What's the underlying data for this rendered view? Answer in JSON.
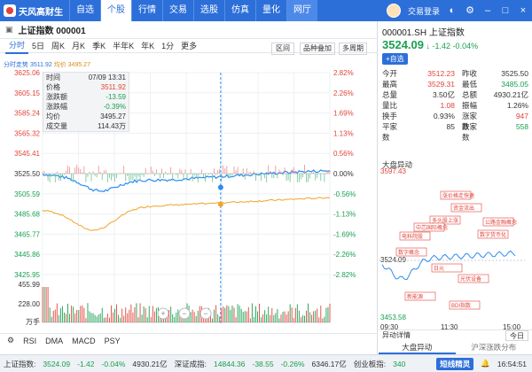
{
  "app": {
    "name": "天风高财生"
  },
  "nav": {
    "tabs": [
      "自选",
      "个股",
      "行情",
      "交易",
      "选股",
      "仿真",
      "量化",
      "网厅"
    ],
    "active": "个股",
    "login": "交易登录"
  },
  "stock": {
    "title": "上证指数 000001",
    "code_title": "000001.SH 上证指数",
    "price": "3524.09",
    "arrow": "↓",
    "change": "-1.42",
    "pct": "-0.04%",
    "add": "+自选"
  },
  "periods": [
    "分时",
    "5日",
    "周K",
    "月K",
    "季K",
    "半年K",
    "年K",
    "1分",
    "更多"
  ],
  "chart_buttons": {
    "a": "区间",
    "b": "品种叠加",
    "c": "多周期"
  },
  "legend": {
    "fs": "分时走势",
    "p1": "3511.92",
    "avg_label": "均价",
    "p2": "3495.27"
  },
  "info": {
    "rows": [
      [
        "时间",
        "07/09 13:31"
      ],
      [
        "价格",
        "3511.92"
      ],
      [
        "涨跌额",
        "-13.59"
      ],
      [
        "涨跌幅",
        "-0.39%"
      ],
      [
        "均价",
        "3495.27"
      ],
      [
        "成交量",
        "114.43万"
      ]
    ]
  },
  "axis": {
    "left": [
      "3625.06",
      "3605.15",
      "3585.24",
      "3565.32",
      "3545.41",
      "3525.50",
      "3505.59",
      "3485.68",
      "3465.77",
      "3445.86",
      "3425.95"
    ],
    "right": [
      "2.82%",
      "2.26%",
      "1.69%",
      "1.13%",
      "0.56%",
      "0.00%",
      "-0.56%",
      "-1.13%",
      "-1.69%",
      "-2.26%",
      "-2.82%"
    ],
    "vol": [
      "455.99",
      "228.00",
      "万手"
    ],
    "time": [
      "09:30",
      "10:00",
      "10:30",
      "11:00",
      "11:30",
      "07-09 13:31",
      "14:00",
      "14:30",
      "15:00"
    ]
  },
  "bottom_tabs": [
    "RSI",
    "DMA",
    "MACD",
    "PSY"
  ],
  "quote": {
    "rows": [
      [
        "今开",
        "3512.23",
        "昨收",
        "3525.50"
      ],
      [
        "最高",
        "3529.31",
        "最低",
        "3485.05"
      ],
      [
        "总量",
        "3.50亿",
        "总额",
        "4930.21亿"
      ],
      [
        "量比",
        "1.08",
        "振幅",
        "1.26%"
      ],
      [
        "换手",
        "0.93%",
        "涨家数",
        "947"
      ],
      [
        "平家数",
        "85",
        "跌家数",
        "558"
      ]
    ]
  },
  "mini": {
    "title": "大盘异动",
    "top": "3597.43",
    "mid": "3524.09",
    "low": "3453.58",
    "t1": "09:30",
    "t2": "11:30",
    "t3": "15:00",
    "labels": [
      "涨价格走快速",
      "资金流出",
      "多头股上涨",
      "中芯国际概念",
      "电科院股",
      "公路金融概念",
      "数字货币化",
      "数字概念",
      "日元",
      "光伏设备",
      "新能源",
      "BDI指数"
    ]
  },
  "rb": {
    "a": "异动详情",
    "b": "今日",
    "c": "大盘异动",
    "d": "沪深涨跌分布"
  },
  "status": {
    "sh_name": "上证指数:",
    "sh_val": "3524.09",
    "sh_chg": "-1.42",
    "sh_pct": "-0.04%",
    "sh_amt": "4930.21亿",
    "sz_name": "深证成指:",
    "sz_val": "14844.36",
    "sz_chg": "-38.55",
    "sz_pct": "-0.26%",
    "sz_amt": "6346.17亿",
    "cy_name": "创业板指:",
    "cy_val": "340",
    "pill": "短线精灵",
    "time": "16:54:51"
  }
}
